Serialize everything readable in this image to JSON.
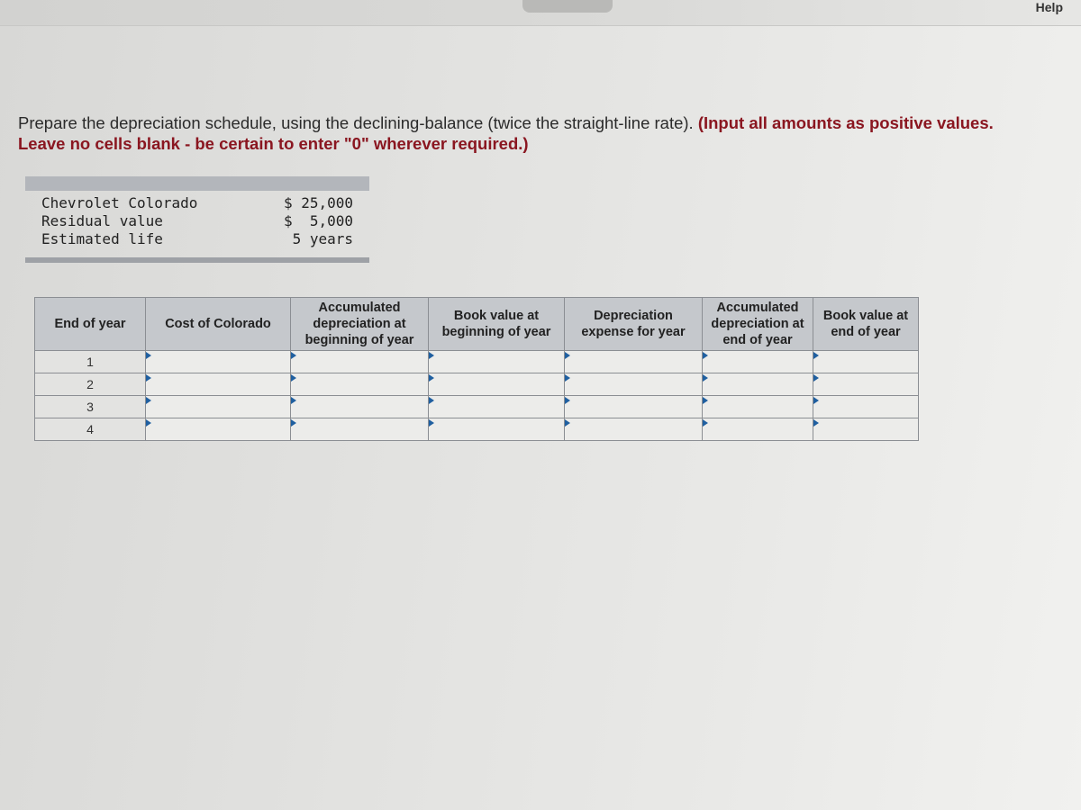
{
  "header": {
    "help_label": "Help"
  },
  "instructions": {
    "main": "Prepare the depreciation schedule, using the declining-balance (twice the straight-line rate). ",
    "emphasis_1": "(Input all amounts as positive values.",
    "emphasis_2": "Leave no cells blank - be certain to enter \"0\" wherever required.)"
  },
  "info": {
    "rows": [
      {
        "label": "Chevrolet Colorado",
        "value": "$ 25,000"
      },
      {
        "label": "Residual value",
        "value": "$  5,000"
      },
      {
        "label": "Estimated life",
        "value": " 5 years"
      }
    ]
  },
  "table": {
    "headers": [
      "End of year",
      "Cost of Colorado",
      "Accumulated depreciation at beginning of year",
      "Book value at beginning of year",
      "Depreciation expense for year",
      "Accumulated depreciation at end of year",
      "Book value at end of year"
    ],
    "rows": [
      {
        "year": "1",
        "values": [
          "",
          "",
          "",
          "",
          "",
          ""
        ]
      },
      {
        "year": "2",
        "values": [
          "",
          "",
          "",
          "",
          "",
          ""
        ]
      },
      {
        "year": "3",
        "values": [
          "",
          "",
          "",
          "",
          "",
          ""
        ]
      },
      {
        "year": "4",
        "values": [
          "",
          "",
          "",
          "",
          "",
          ""
        ]
      }
    ]
  }
}
